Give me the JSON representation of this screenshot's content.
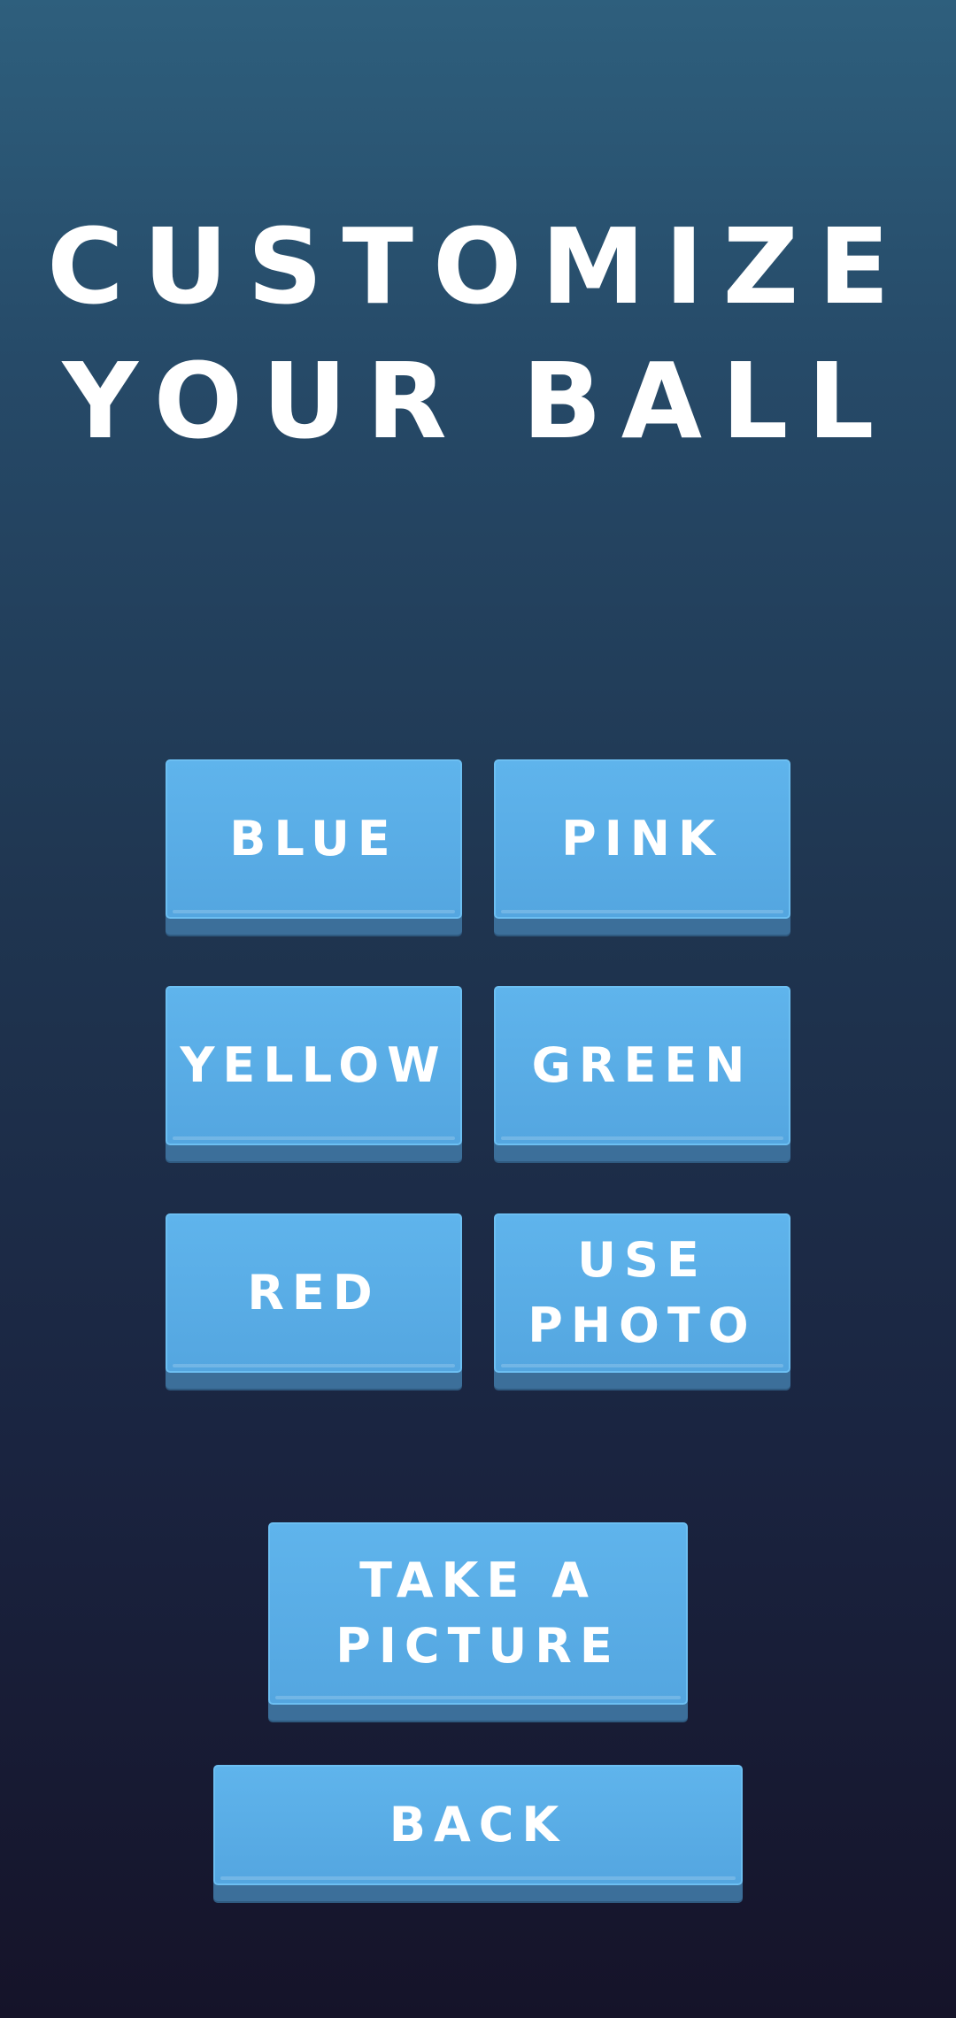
{
  "screen": {
    "title_line1": "CUSTOMIZE",
    "title_line2": "YOUR BALL"
  },
  "colors": {
    "background_top": "#2e5f7d",
    "background_bottom": "#151329",
    "button_fill": "#5aaee6",
    "button_shadow": "#3c6f9a",
    "text": "#ffffff"
  },
  "options": {
    "blue": "BLUE",
    "pink": "PINK",
    "yellow": "YELLOW",
    "green": "GREEN",
    "red": "RED",
    "use_photo_line1": "USE",
    "use_photo_line2": "PHOTO"
  },
  "actions": {
    "take_picture_line1": "TAKE A",
    "take_picture_line2": "PICTURE",
    "back": "BACK"
  }
}
